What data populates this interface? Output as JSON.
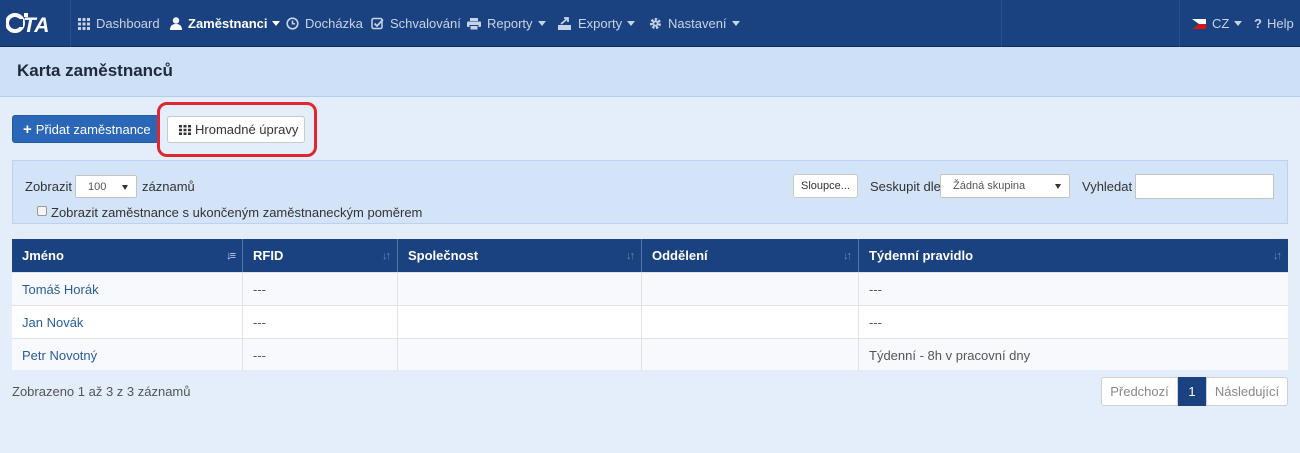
{
  "brand": {
    "logo_text": "iTA",
    "nav_bg": "#1b4280"
  },
  "nav": {
    "items": [
      {
        "label": "Dashboard",
        "icon": "grid-icon"
      },
      {
        "label": "Zaměstnanci",
        "icon": "user-icon",
        "active": true,
        "dropdown": true
      },
      {
        "label": "Docházka",
        "icon": "clock-icon"
      },
      {
        "label": "Schvalování",
        "icon": "check-square-icon"
      },
      {
        "label": "Reporty",
        "icon": "print-icon",
        "dropdown": true
      },
      {
        "label": "Exporty",
        "icon": "export-icon",
        "dropdown": true
      },
      {
        "label": "Nastavení",
        "icon": "gear-icon",
        "dropdown": true
      }
    ],
    "language": "CZ",
    "help": "Help"
  },
  "page": {
    "title": "Karta zaměstnanců"
  },
  "actions": {
    "add_employee": "Přidat zaměstnance",
    "bulk_edit": "Hromadné úpravy",
    "highlight_color": "#e0262e"
  },
  "filters": {
    "show_label": "Zobrazit",
    "page_size": "100",
    "records_label": "záznamů",
    "columns_button": "Sloupce...",
    "group_label": "Seskupit dle",
    "group_value": "Žádná skupina",
    "search_label": "Vyhledat",
    "search_value": "",
    "show_terminated_label": "Zobrazit zaměstnance s ukončeným zaměstnaneckým poměrem",
    "show_terminated_checked": false
  },
  "table": {
    "columns": [
      "Jméno",
      "RFID",
      "Společnost",
      "Oddělení",
      "Týdenní pravidlo"
    ],
    "rows": [
      {
        "name": "Tomáš Horák",
        "rfid": "---",
        "company": "",
        "department": "",
        "weekly_rule": "---"
      },
      {
        "name": "Jan Novák",
        "rfid": "---",
        "company": "",
        "department": "",
        "weekly_rule": "---"
      },
      {
        "name": "Petr Novotný",
        "rfid": "---",
        "company": "",
        "department": "",
        "weekly_rule": "Týdenní - 8h v pracovní dny"
      }
    ]
  },
  "footer": {
    "info": "Zobrazeno 1 až 3 z 3 záznamů",
    "prev": "Předchozí",
    "current_page": "1",
    "next": "Následující"
  }
}
